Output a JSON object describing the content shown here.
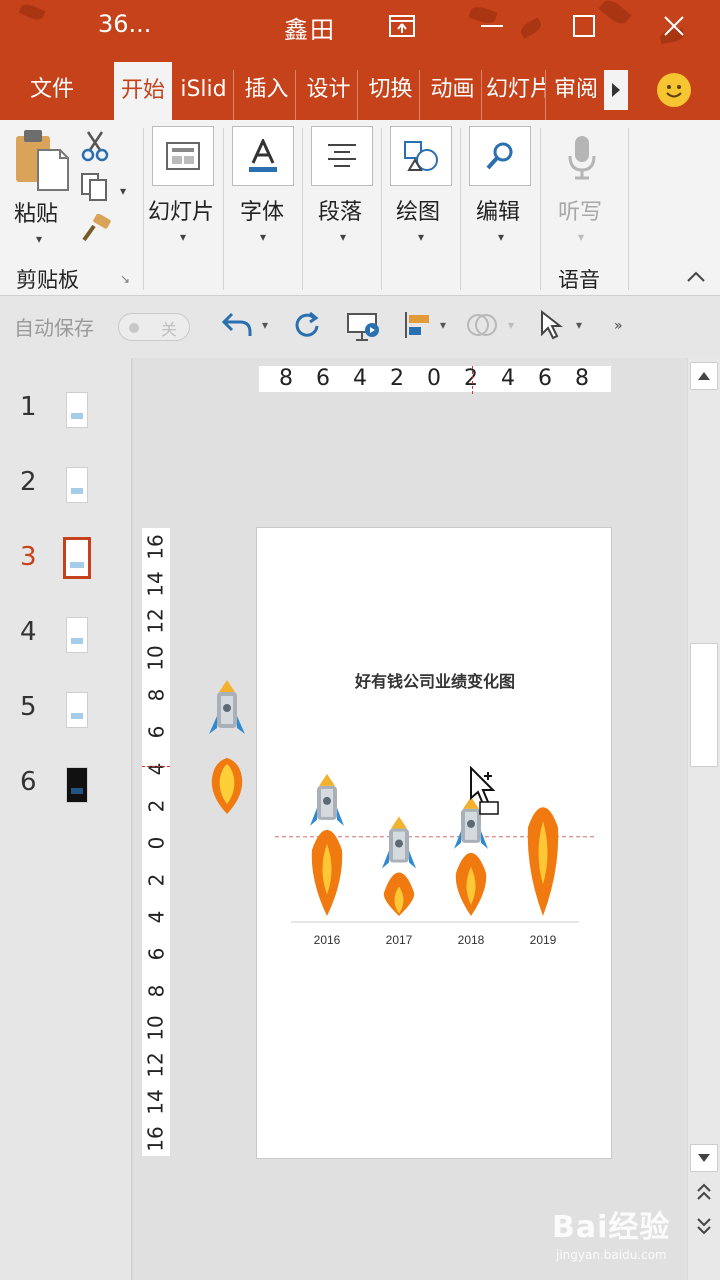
{
  "window": {
    "app_title": "36...",
    "doc_title": "鑫田",
    "buttons": {
      "restore": "⊡",
      "minimize": "—",
      "maximize": "☐",
      "close": "✕"
    }
  },
  "ribbon_tabs": [
    "文件",
    "开始",
    "iSlid",
    "插入",
    "设计",
    "切换",
    "动画",
    "幻灯片",
    "审阅"
  ],
  "active_tab": "开始",
  "ribbon": {
    "paste_label": "粘贴",
    "clipboard_group": "剪贴板",
    "slides_label": "幻灯片",
    "font_label": "字体",
    "paragraph_label": "段落",
    "drawing_label": "绘图",
    "editing_label": "编辑",
    "dictate_label": "听写",
    "voice_group": "语音"
  },
  "qat": {
    "autosave_label": "自动保存",
    "autosave_state": "关"
  },
  "slides": [
    {
      "num": "1",
      "dark": false
    },
    {
      "num": "2",
      "dark": false
    },
    {
      "num": "3",
      "dark": false,
      "active": true
    },
    {
      "num": "4",
      "dark": false
    },
    {
      "num": "5",
      "dark": false
    },
    {
      "num": "6",
      "dark": true
    }
  ],
  "hruler": [
    "8",
    "6",
    "4",
    "2",
    "0",
    "2",
    "4",
    "6",
    "8"
  ],
  "vruler": [
    "16",
    "14",
    "12",
    "10",
    "8",
    "6",
    "4",
    "2",
    "0",
    "2",
    "4",
    "6",
    "8",
    "10",
    "12",
    "14",
    "16"
  ],
  "chart_data": {
    "type": "bar",
    "title": "好有钱公司业绩变化图",
    "categories": [
      "2016",
      "2017",
      "2018",
      "2019"
    ],
    "values": [
      3.6,
      2.3,
      2.9,
      3.5
    ],
    "reference_line": 2.6,
    "ylim": [
      0,
      5
    ],
    "rocket_on_bar": [
      true,
      true,
      true,
      false
    ],
    "colors": {
      "flame_outer": "#f07a10",
      "flame_inner": "#ffcf3a",
      "ref_line": "#d66a6a",
      "axis": "#cfcfcf"
    }
  },
  "watermark": {
    "text": "Bai经验",
    "url": "jingyan.baidu.com"
  }
}
